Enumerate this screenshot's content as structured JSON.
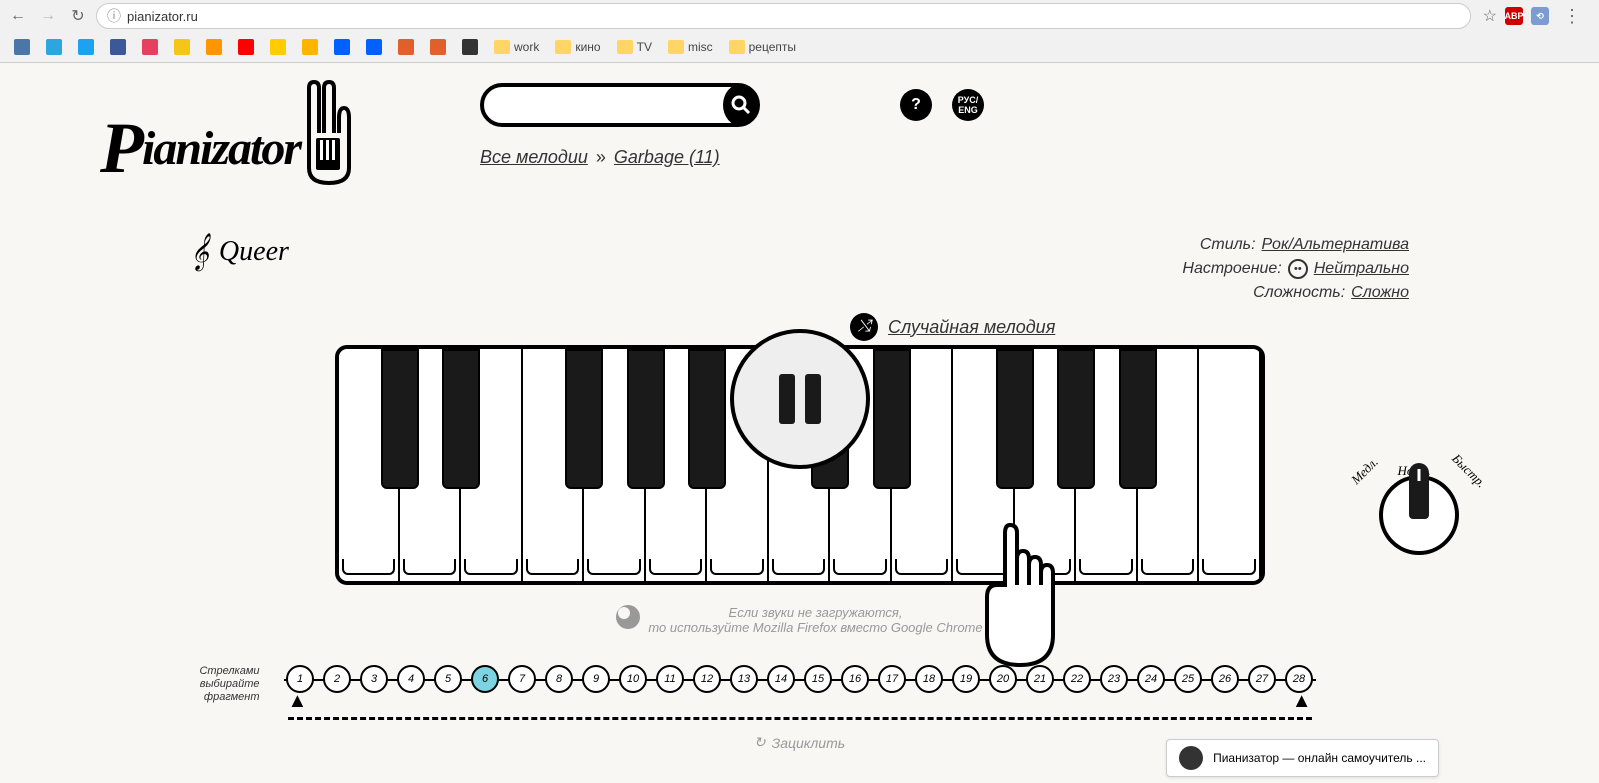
{
  "browser": {
    "url": "pianizator.ru",
    "bookmarks": [
      {
        "label": "",
        "color": "#4a76a8"
      },
      {
        "label": "",
        "color": "#2ca5e0"
      },
      {
        "label": "",
        "color": "#1da1f2"
      },
      {
        "label": "",
        "color": "#3b5998"
      },
      {
        "label": "",
        "color": "#e4405f"
      },
      {
        "label": "",
        "color": "#f5c518"
      },
      {
        "label": "",
        "color": "#ff9500"
      },
      {
        "label": "",
        "color": "#ff0000"
      },
      {
        "label": "",
        "color": "#ffcc00"
      },
      {
        "label": "",
        "color": "#ffb400"
      },
      {
        "label": "",
        "color": "#0061ff"
      },
      {
        "label": "",
        "color": "#0061ff"
      },
      {
        "label": "",
        "color": "#e0602c"
      },
      {
        "label": "",
        "color": "#e0602c"
      },
      {
        "label": "",
        "color": "#333"
      }
    ],
    "folders": [
      "work",
      "кино",
      "TV",
      "misc",
      "рецепты"
    ]
  },
  "logo": "Pianizator",
  "search": {
    "placeholder": ""
  },
  "help_label": "?",
  "lang_label": "РУС/\nENG",
  "breadcrumb": {
    "all": "Все мелодии",
    "sep": "»",
    "artist": "Garbage (11)"
  },
  "song": {
    "title": "Queer"
  },
  "meta": {
    "style_label": "Стиль:",
    "style_value": "Рок/Альтернатива",
    "mood_label": "Настроение:",
    "mood_value": "Нейтрально",
    "difficulty_label": "Сложность:",
    "difficulty_value": "Сложно"
  },
  "random": {
    "label": "Случайная мелодия"
  },
  "tempo": {
    "slow": "Медл.",
    "normal": "Норм.",
    "fast": "Быстр."
  },
  "hint": {
    "line1": "Если звуки не загружаются,",
    "line2": "то используйте Mozilla Firefox вместо Google Chrome"
  },
  "fragments": {
    "label": "Стрелками выбирайте фрагмент",
    "count": 28,
    "active": 6
  },
  "loop": {
    "label": "Зациклить"
  },
  "widget": {
    "title": "Пианизатор — онлайн самоучитель ..."
  }
}
